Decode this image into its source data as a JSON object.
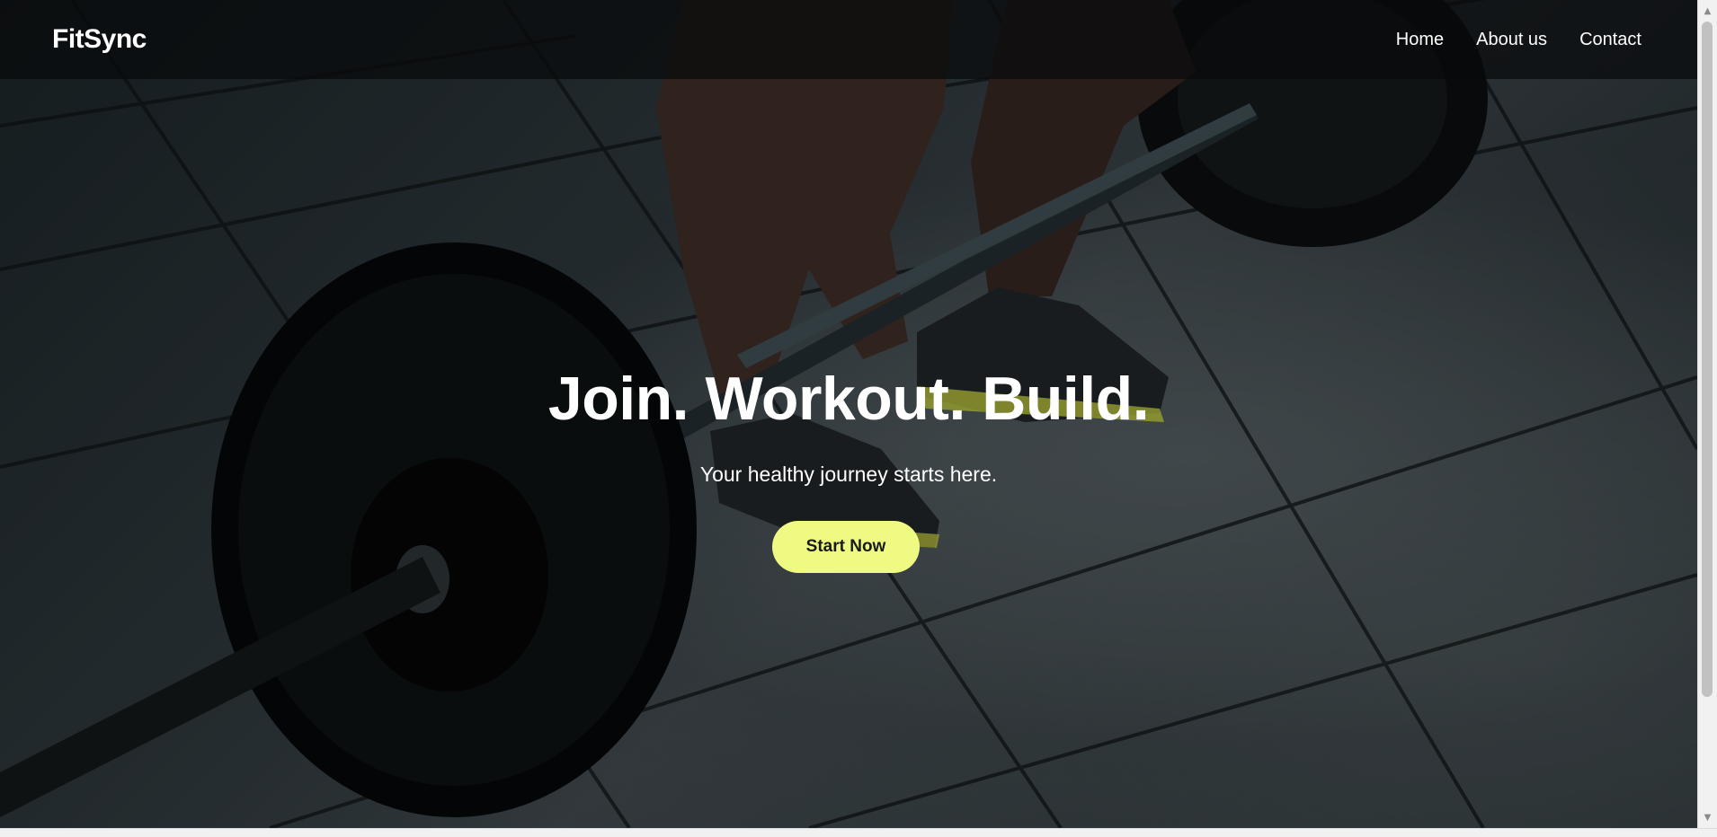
{
  "navbar": {
    "brand": "FitSync",
    "links": [
      {
        "label": "Home"
      },
      {
        "label": "About us"
      },
      {
        "label": "Contact"
      }
    ]
  },
  "hero": {
    "title": "Join. Workout. Build.",
    "subtitle": "Your healthy journey starts here.",
    "cta_label": "Start Now",
    "background_image": "deadlift-barbell-gym-floor-photo"
  },
  "scrollbar": {
    "up_icon": "triangle-up-icon",
    "down_icon": "triangle-down-icon"
  },
  "colors": {
    "accent": "#eefa82",
    "navbar_bg": "#080a0b",
    "text": "#ffffff"
  }
}
